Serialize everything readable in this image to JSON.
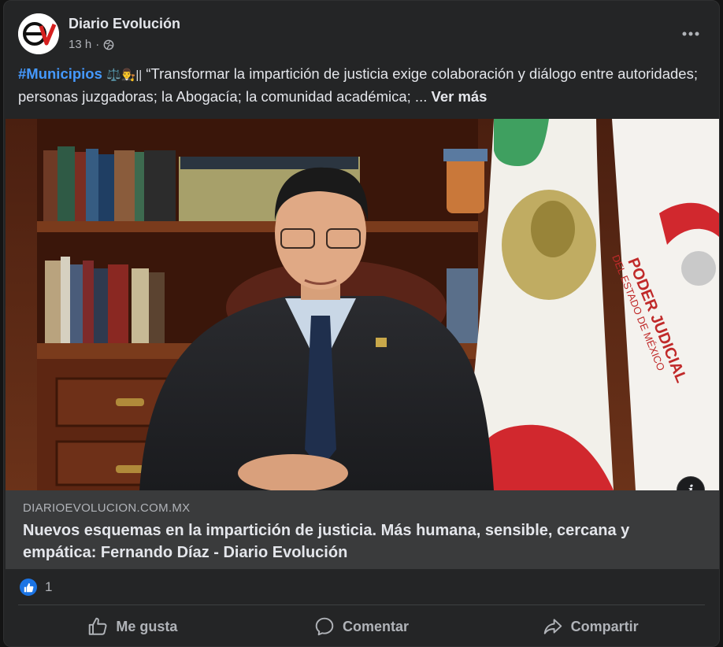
{
  "post": {
    "author": "Diario Evolución",
    "time": "13 h",
    "hashtag": "#Municipios",
    "emojis": "⚖️👨‍⚖️||",
    "text": "“Transformar la impartición de justicia exige colaboración y diálogo entre autoridades; personas juzgadoras; la Abogacía; la comunidad académica; ...",
    "see_more": "Ver más"
  },
  "image": {
    "seal_text_top": "PODER JUDICIAL",
    "seal_text_bottom": "DEL ESTADO DE MÉXICO"
  },
  "link": {
    "domain": "DIARIOEVOLUCION.COM.MX",
    "title": "Nuevos esquemas en la impartición de justicia. Más humana, sensible, cercana y empática: Fernando Díaz - Diario Evolución"
  },
  "reactions": {
    "count": "1"
  },
  "actions": {
    "like": "Me gusta",
    "comment": "Comentar",
    "share": "Compartir"
  },
  "colors": {
    "card": "#242526",
    "hashtag": "#4599ff",
    "like_blue": "#1b74e4"
  }
}
